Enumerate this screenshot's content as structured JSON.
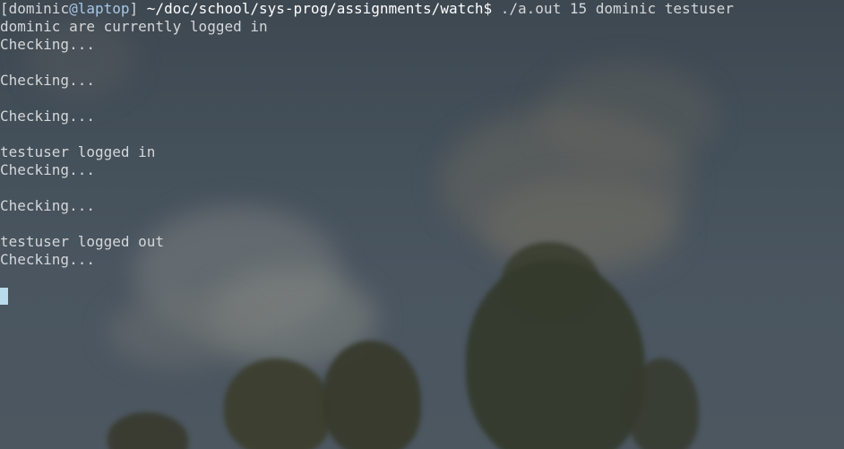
{
  "terminal": {
    "prompt": {
      "open_bracket": "[",
      "user": "dominic",
      "at": "@",
      "host": "laptop",
      "close_bracket": "]",
      "path": "~/doc/school/sys-prog/assignments/watch",
      "symbol": "$",
      "command": "./a.out 15 dominic testuser"
    },
    "output_lines": [
      "dominic are currently logged in",
      "Checking...",
      "",
      "Checking...",
      "",
      "Checking...",
      "",
      "testuser logged in",
      "Checking...",
      "",
      "Checking...",
      "",
      "testuser logged out",
      "Checking...",
      ""
    ]
  },
  "colors": {
    "foreground": "#d4d7d9",
    "host": "#a7c6e6",
    "path": "#ffffff",
    "cursor": "#b8dceb"
  }
}
